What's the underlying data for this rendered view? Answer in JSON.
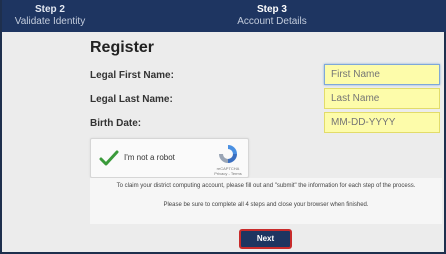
{
  "steps": [
    {
      "number": "Step 2",
      "name": "Validate Identity"
    },
    {
      "number": "Step 3",
      "name": "Account Details"
    }
  ],
  "form": {
    "title": "Register",
    "first_name_label": "Legal First Name:",
    "first_name_placeholder": "First Name",
    "last_name_label": "Legal Last Name:",
    "last_name_placeholder": "Last Name",
    "birth_date_label": "Birth Date:",
    "birth_date_placeholder": "MM-DD-YYYY"
  },
  "captcha": {
    "label": "I'm not a robot",
    "brand": "reCAPTCHA",
    "links": "Privacy - Terms"
  },
  "info": {
    "line1": "To claim your district computing account, please fill out and \"submit\" the information for each step of the process.",
    "line2": "Please be sure to complete all 4 steps and close your browser when finished."
  },
  "next_label": "Next",
  "colors": {
    "header": "#1e3561",
    "field_bg": "#fdfcaa",
    "highlight": "#c82b2b",
    "check": "#3a9a3a"
  }
}
